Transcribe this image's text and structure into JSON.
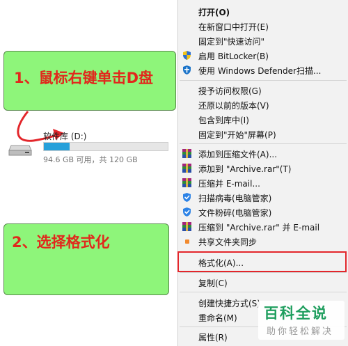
{
  "callouts": {
    "step1": "1、鼠标右键单击D盘",
    "step2": "2、选择格式化"
  },
  "drive": {
    "name": "软件库 (D:)",
    "size_text": "94.6 GB 可用，共 120 GB",
    "used_fraction": 0.21,
    "icon": "hard-drive-icon"
  },
  "menu": {
    "items": [
      {
        "label": "打开(O)",
        "icon": ""
      },
      {
        "label": "在新窗口中打开(E)",
        "icon": ""
      },
      {
        "label": "固定到\"快速访问\"",
        "icon": ""
      },
      {
        "label": "启用 BitLocker(B)",
        "icon": "shield-icon"
      },
      {
        "label": "使用 Windows Defender扫描...",
        "icon": "defender-icon"
      },
      {
        "label": "授予访问权限(G)",
        "icon": ""
      },
      {
        "label": "还原以前的版本(V)",
        "icon": ""
      },
      {
        "label": "包含到库中(I)",
        "icon": ""
      },
      {
        "label": "固定到\"开始\"屏幕(P)",
        "icon": ""
      },
      {
        "label": "添加到压缩文件(A)...",
        "icon": "winrar-icon"
      },
      {
        "label": "添加到 \"Archive.rar\"(T)",
        "icon": "winrar-icon"
      },
      {
        "label": "压缩并 E-mail...",
        "icon": "winrar-icon"
      },
      {
        "label": "扫描病毒(电脑管家)",
        "icon": "tencent-guard-icon"
      },
      {
        "label": "文件粉碎(电脑管家)",
        "icon": "tencent-guard-icon"
      },
      {
        "label": "压缩到 \"Archive.rar\" 并 E-mail",
        "icon": "winrar-icon"
      },
      {
        "label": "共享文件夹同步",
        "icon": "sync-icon"
      },
      {
        "label": "格式化(A)...",
        "icon": ""
      },
      {
        "label": "复制(C)",
        "icon": ""
      },
      {
        "label": "创建快捷方式(S)",
        "icon": ""
      },
      {
        "label": "重命名(M)",
        "icon": ""
      },
      {
        "label": "属性(R)",
        "icon": ""
      }
    ]
  },
  "watermark": {
    "title": "百科全说",
    "subtitle": "助你轻松解决"
  },
  "colors": {
    "callout_bg": "#8ef57a",
    "callout_text": "#e1281c",
    "highlight": "#e3262b",
    "menu_bg": "#f2f2f2",
    "drive_bar": "#26a0da",
    "watermark": "#1f9e5e"
  }
}
